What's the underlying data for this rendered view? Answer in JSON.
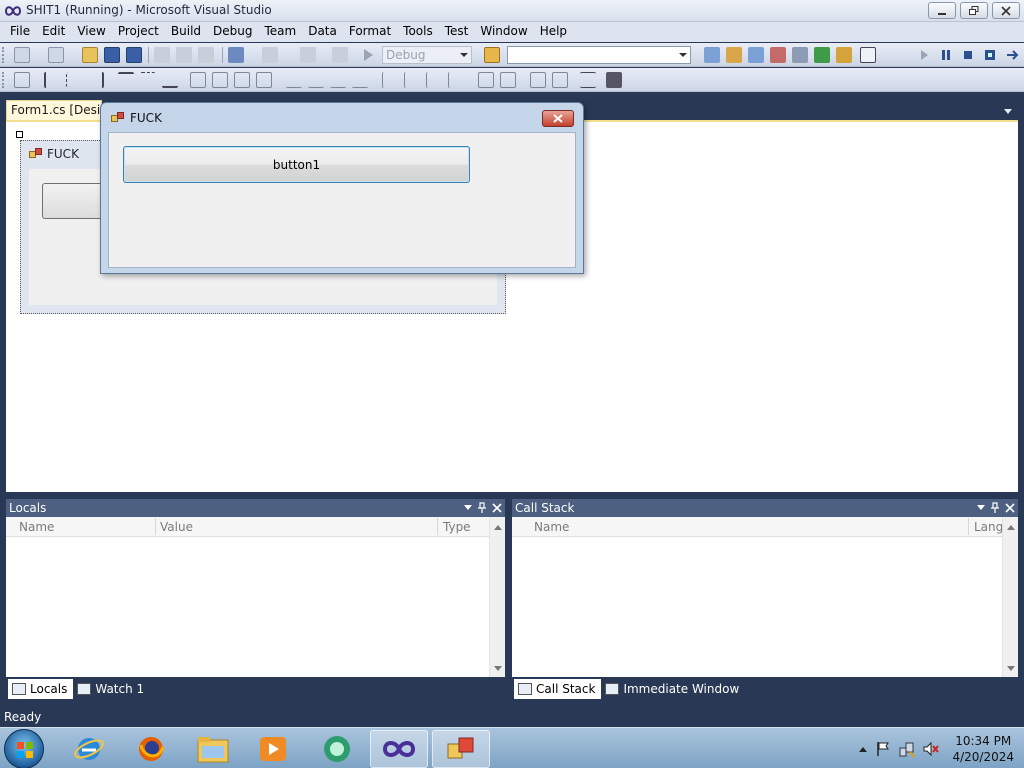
{
  "window": {
    "title": "SHIT1 (Running) - Microsoft Visual Studio"
  },
  "menu": [
    "File",
    "Edit",
    "View",
    "Project",
    "Build",
    "Debug",
    "Team",
    "Data",
    "Format",
    "Tools",
    "Test",
    "Window",
    "Help"
  ],
  "toolbar": {
    "config_combo": "Debug",
    "find_combo": ""
  },
  "document": {
    "tab_label": "Form1.cs [Design]"
  },
  "design_form": {
    "title": "FUCK"
  },
  "running_form": {
    "title": "FUCK",
    "button_label": "button1"
  },
  "locals": {
    "title": "Locals",
    "columns": [
      "Name",
      "Value",
      "Type"
    ]
  },
  "callstack": {
    "title": "Call Stack",
    "columns": [
      "Name",
      "Lang"
    ]
  },
  "left_tabs": [
    "Locals",
    "Watch 1"
  ],
  "right_tabs": [
    "Call Stack",
    "Immediate Window"
  ],
  "status": "Ready",
  "clock": {
    "time": "10:34 PM",
    "date": "4/20/2024"
  },
  "colors": {
    "ide_background": "#293955",
    "doc_tab": "#fff8dc",
    "close_button": "#c3412e"
  },
  "taskbar_apps": [
    "internet-explorer-icon",
    "firefox-icon",
    "file-explorer-icon",
    "media-player-icon",
    "sharex-icon",
    "visual-studio-icon",
    "winforms-app-icon"
  ]
}
